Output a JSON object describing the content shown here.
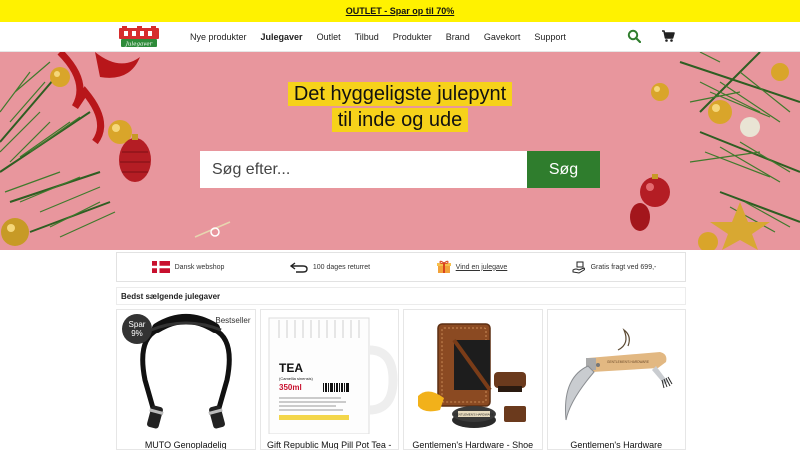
{
  "topbar": {
    "promo": "OUTLET - Spar op til 70%"
  },
  "header": {
    "logo_text": "Julegaver",
    "nav": [
      "Nye produkter",
      "Julegaver",
      "Outlet",
      "Tilbud",
      "Produkter",
      "Brand",
      "Gavekort",
      "Support"
    ],
    "active_nav": "Julegaver"
  },
  "hero": {
    "line1": "Det hyggeligste julepynt",
    "line2": "til inde og ude",
    "search_placeholder": "Søg efter...",
    "search_button": "Søg"
  },
  "usp": [
    {
      "icon": "danish-flag-icon",
      "text": "Dansk webshop"
    },
    {
      "icon": "return-arrow-icon",
      "text": "100 dages returret"
    },
    {
      "icon": "gift-icon",
      "text": "Vind en julegave"
    },
    {
      "icon": "hand-delivery-icon",
      "text": "Gratis fragt ved 699,-"
    }
  ],
  "bestsellers": {
    "title": "Bedst sælgende julegaver",
    "products": [
      {
        "title": "MUTO Genopladelig",
        "discount_badge": "Spar 9%",
        "tag": "Bestseller"
      },
      {
        "title": "Gift Republic Mug Pill Pot Tea -",
        "mug_label": "TEA",
        "mug_sub": "(Camellia sinensis)",
        "mug_volume": "350ml"
      },
      {
        "title": "Gentlemen's Hardware - Shoe",
        "tin_label": "GENTLEMEN'S HARDWARE"
      },
      {
        "title": "Gentlemen's Hardware",
        "knife_label": "GENTLEMEN'S HARDWARE"
      }
    ]
  },
  "colors": {
    "topbar": "#fff200",
    "hero_bg": "#e8969d",
    "headline_bg": "#f6d21a",
    "search_button": "#2f7d2d"
  }
}
